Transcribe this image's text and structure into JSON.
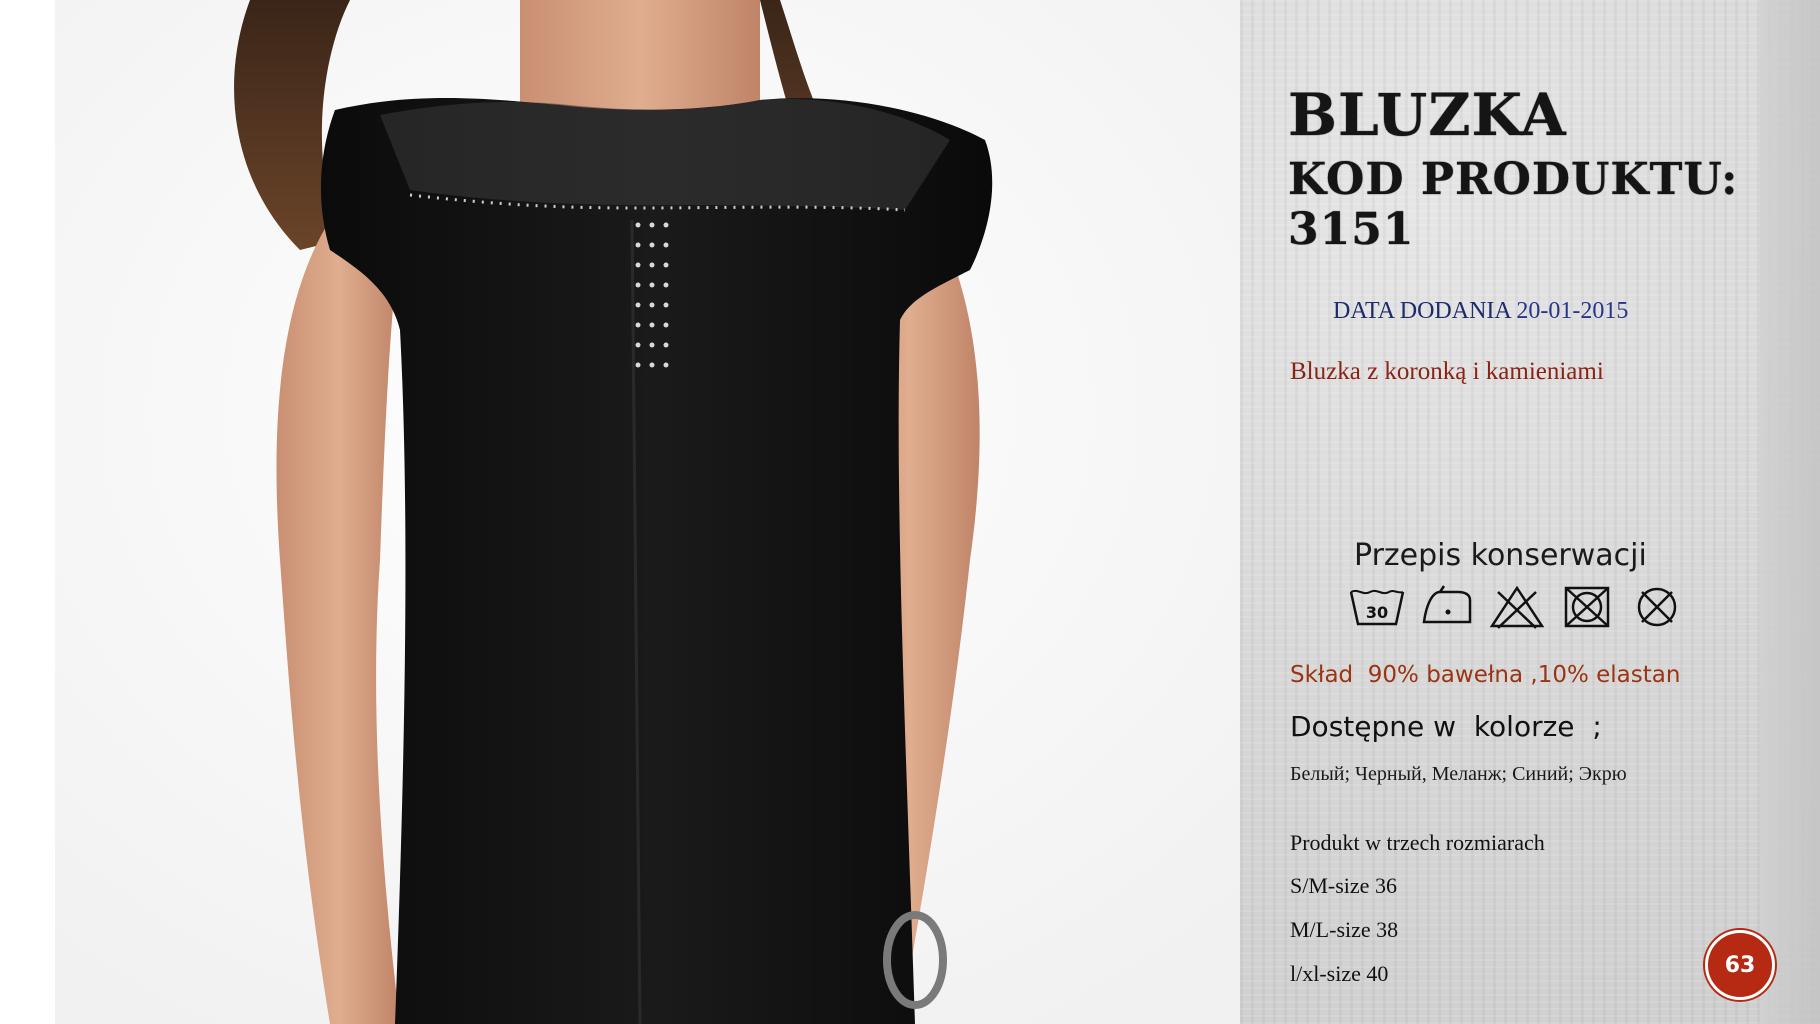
{
  "title": {
    "line1": "BLUZKA",
    "line2": "KOD PRODUKTU: 3151"
  },
  "date": {
    "label": "DATA DODANIA",
    "value": "20-01-2015"
  },
  "description": "Bluzka z koronką i kamieniami",
  "care": {
    "title": "Przepis konserwacji",
    "icons": [
      "wash-30-icon",
      "iron-low-icon",
      "no-bleach-icon",
      "no-tumble-dry-icon",
      "no-dry-clean-icon"
    ],
    "wash_temp": "30"
  },
  "composition": "Skład  90% bawełna ,10% elastan",
  "colors": {
    "heading": "Dostępne w  kolorze  ;",
    "list": "Белый; Черный, Меланж; Синий; Экрю"
  },
  "sizes": {
    "heading": "Produkt w trzech rozmiarach",
    "items": [
      "S/M-size 36",
      "M/L-size 38",
      "l/xl-size 40"
    ]
  },
  "page_number": "63",
  "colors_theme": {
    "title": "#151515",
    "date": "#1d2b6b",
    "accent_red": "#b62a14",
    "description": "#8a2313"
  }
}
